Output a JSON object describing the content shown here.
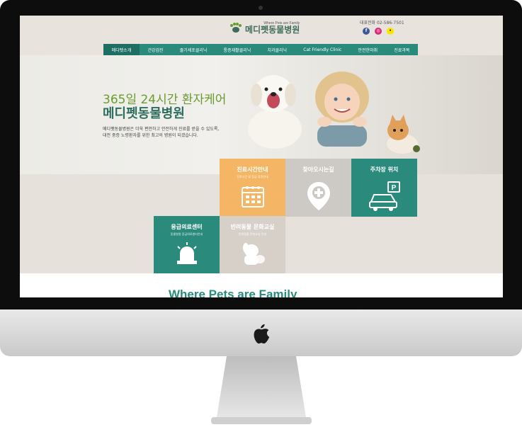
{
  "header": {
    "logo_tagline": "Where Pets are Family",
    "logo_name": "메디펫동물병원",
    "phone": "대표전화 02-586-7501",
    "social": [
      "f",
      "ig",
      "talk"
    ]
  },
  "nav": {
    "items": [
      "메디펫소개",
      "건강검진",
      "줄기세포클리닉",
      "통증재활클리닉",
      "치과클리닉",
      "Cat Friendly Clinic",
      "안전한마취",
      "진료과목"
    ],
    "active": 0
  },
  "hero": {
    "title": "365일 24시간 환자케어",
    "subtitle": "메디펫동물병원",
    "description_line1": "메디펫동물병원은 더욱 편안하고 안전하게 진료를 받을 수 있도록,",
    "description_line2": "대전 중증 노령환자를 위한 최고의 병원이 되겠습니다."
  },
  "tiles": [
    {
      "title": "진료시간안내",
      "sub": "진료시간 및 응급 휴진안내",
      "icon": "calendar-icon",
      "color": "#f4b564"
    },
    {
      "title": "찾아오시는길",
      "sub": "",
      "icon": "location-pin-icon",
      "color": "#cdc9c5"
    },
    {
      "title": "주차장 위치",
      "sub": "",
      "icon": "parking-car-icon",
      "color": "#2a8a7c"
    },
    {
      "title": "응급의료센터",
      "sub": "동물병원 응급의료센터안내",
      "icon": "siren-icon",
      "color": "#2a8a7c"
    },
    {
      "title": "반려동물 문화교실",
      "sub": "반려동물 문화교실 안내",
      "icon": "dog-cat-icon",
      "color": "#d6d0c8"
    }
  ],
  "brand_slogan": "Where Pets are Family",
  "colors": {
    "accent": "#2a8a7c",
    "green_text": "#6a9b2f",
    "orange": "#f4b564"
  }
}
